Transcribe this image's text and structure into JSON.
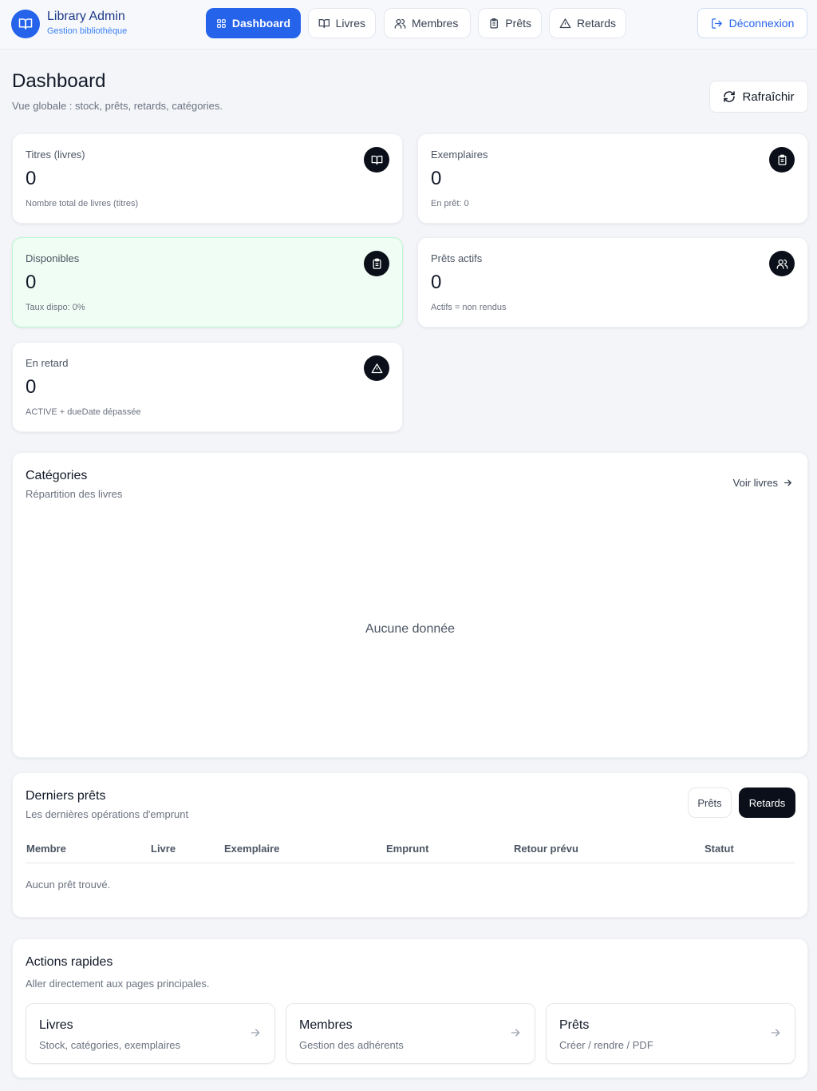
{
  "brand": {
    "title": "Library Admin",
    "subtitle": "Gestion bibliothèque",
    "icon": "book-open-icon"
  },
  "nav": {
    "tabs": [
      {
        "label": "Dashboard",
        "icon": "grid-icon",
        "active": true
      },
      {
        "label": "Livres",
        "icon": "book-open-icon"
      },
      {
        "label": "Membres",
        "icon": "users-icon"
      },
      {
        "label": "Prêts",
        "icon": "clipboard-icon"
      },
      {
        "label": "Retards",
        "icon": "alert-triangle-icon"
      }
    ],
    "logout_label": "Déconnexion"
  },
  "header": {
    "title": "Dashboard",
    "subtitle": "Vue globale : stock, prêts, retards, catégories.",
    "refresh_label": "Rafraîchir"
  },
  "stats": [
    {
      "label": "Titres (livres)",
      "value": "0",
      "note": "Nombre total de livres (titres)",
      "icon": "book-open-icon"
    },
    {
      "label": "Exemplaires",
      "value": "0",
      "note": "En prêt: 0",
      "icon": "clipboard-icon"
    },
    {
      "label": "Disponibles",
      "value": "0",
      "note": "Taux dispo: 0%",
      "icon": "clipboard-icon"
    },
    {
      "label": "Prêts actifs",
      "value": "0",
      "note": "Actifs = non rendus",
      "icon": "users-icon"
    },
    {
      "label": "En retard",
      "value": "0",
      "note": "ACTIVE + dueDate dépassée",
      "icon": "alert-triangle-icon"
    }
  ],
  "categories": {
    "title": "Catégories",
    "subtitle": "Répartition des livres",
    "link_label": "Voir livres",
    "empty_label": "Aucune donnée"
  },
  "loans": {
    "title": "Derniers prêts",
    "subtitle": "Les dernières opérations d'emprunt",
    "btn_loans": "Prêts",
    "btn_late": "Retards",
    "columns": [
      "Membre",
      "Livre",
      "Exemplaire",
      "Emprunt",
      "Retour prévu",
      "Statut"
    ],
    "empty_label": "Aucun prêt trouvé."
  },
  "quick_actions": {
    "title": "Actions rapides",
    "subtitle": "Aller directement aux pages principales.",
    "items": [
      {
        "title": "Livres",
        "subtitle": "Stock, catégories, exemplaires"
      },
      {
        "title": "Membres",
        "subtitle": "Gestion des adhérents"
      },
      {
        "title": "Prêts",
        "subtitle": "Créer / rendre / PDF"
      }
    ]
  },
  "colors": {
    "accent": "#2563eb",
    "dark": "#0b0f19",
    "available_bg": "#f0fdf4"
  }
}
